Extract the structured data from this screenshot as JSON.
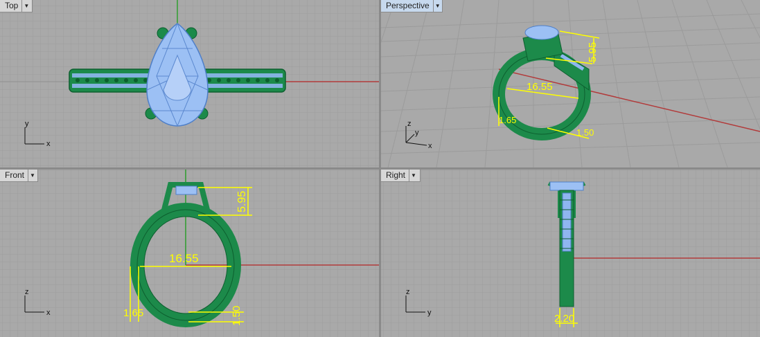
{
  "viewports": {
    "top": {
      "name": "Top",
      "axis_labels": [
        "y",
        "x"
      ]
    },
    "perspective": {
      "name": "Perspective",
      "axis_labels": [
        "z",
        "y",
        "x"
      ],
      "dims": [
        "16.55",
        "5.95",
        "1.65",
        "1.50"
      ]
    },
    "front": {
      "name": "Front",
      "axis_labels": [
        "z",
        "x"
      ],
      "dims": [
        "16.55",
        "5.95",
        "1.65",
        "1.50"
      ]
    },
    "right": {
      "name": "Right",
      "axis_labels": [
        "z",
        "y"
      ],
      "dims": [
        "2.20"
      ]
    }
  },
  "colors": {
    "viewport_bg": "#a9a9a9",
    "grid_minor": "#9e9e9e",
    "grid_major": "#8f8f8f",
    "x_axis": "#b23a3a",
    "y_axis": "#2f9e2f",
    "metal": "#1c8a4a",
    "stone": "#8fb6f0",
    "dimension": "#ffff00",
    "active_tab": "#c7d9ee"
  },
  "icons": {
    "viewport_menu": "dropdown-arrow-icon"
  }
}
